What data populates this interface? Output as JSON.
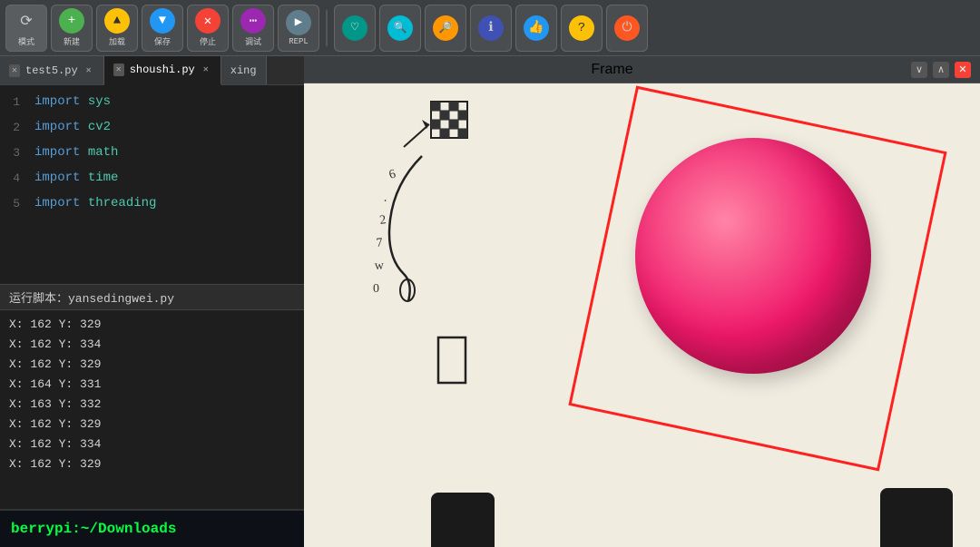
{
  "toolbar": {
    "buttons": [
      {
        "label": "模式",
        "icon": "⚙",
        "colorClass": "btn-logo",
        "name": "mode-button"
      },
      {
        "label": "新建",
        "icon": "+",
        "colorClass": "btn-green",
        "name": "new-button"
      },
      {
        "label": "加载",
        "icon": "↑",
        "colorClass": "btn-yellow",
        "name": "load-button"
      },
      {
        "label": "保存",
        "icon": "↓",
        "colorClass": "btn-blue",
        "name": "save-button"
      },
      {
        "label": "停止",
        "icon": "✕",
        "colorClass": "btn-red",
        "name": "stop-button"
      },
      {
        "label": "调试",
        "icon": "⋯",
        "colorClass": "btn-purple",
        "name": "debug-button"
      },
      {
        "label": "REPL",
        "icon": "▶",
        "colorClass": "btn-gray",
        "name": "repl-button"
      },
      {
        "label": "",
        "icon": "♡",
        "colorClass": "btn-teal",
        "name": "heartbeat-button"
      },
      {
        "label": "",
        "icon": "🔍",
        "colorClass": "btn-cyan",
        "name": "zoom-in-button"
      },
      {
        "label": "",
        "icon": "🔎",
        "colorClass": "btn-orange",
        "name": "zoom-out-button"
      },
      {
        "label": "",
        "icon": "ℹ",
        "colorClass": "btn-indigo",
        "name": "info-button"
      },
      {
        "label": "",
        "icon": "👍",
        "colorClass": "btn-blue",
        "name": "like-button"
      },
      {
        "label": "",
        "icon": "?",
        "colorClass": "btn-yellow",
        "name": "help-button"
      },
      {
        "label": "",
        "icon": "⏻",
        "colorClass": "btn-power",
        "name": "power-button"
      }
    ]
  },
  "tabs": [
    {
      "label": "test5.py",
      "active": false,
      "name": "tab-test5"
    },
    {
      "label": "shoushi.py",
      "active": true,
      "name": "tab-shoushi"
    },
    {
      "label": "xing",
      "active": false,
      "name": "tab-xing"
    }
  ],
  "code": {
    "lines": [
      {
        "num": 1,
        "content": "import sys",
        "kw": "import",
        "mod": "sys"
      },
      {
        "num": 2,
        "content": "import cv2",
        "kw": "import",
        "mod": "cv2"
      },
      {
        "num": 3,
        "content": "import math",
        "kw": "import",
        "mod": "math"
      },
      {
        "num": 4,
        "content": "import time",
        "kw": "import",
        "mod": "time"
      },
      {
        "num": 5,
        "content": "import threading",
        "kw": "import",
        "mod": "threading"
      }
    ]
  },
  "script_label": "运行脚本：yansedingwei.py",
  "output": {
    "lines": [
      "X: 162 Y: 329",
      "X: 162 Y: 334",
      "X: 162 Y: 329",
      "X: 164 Y: 331",
      "X: 163 Y: 332",
      "X: 162 Y: 329",
      "X: 162 Y: 334",
      "X: 162 Y: 329"
    ]
  },
  "terminal": {
    "text": "berrypi:~/Downloads"
  },
  "frame_window": {
    "title": "Frame",
    "controls": [
      "∨",
      "∧",
      "✕"
    ]
  }
}
